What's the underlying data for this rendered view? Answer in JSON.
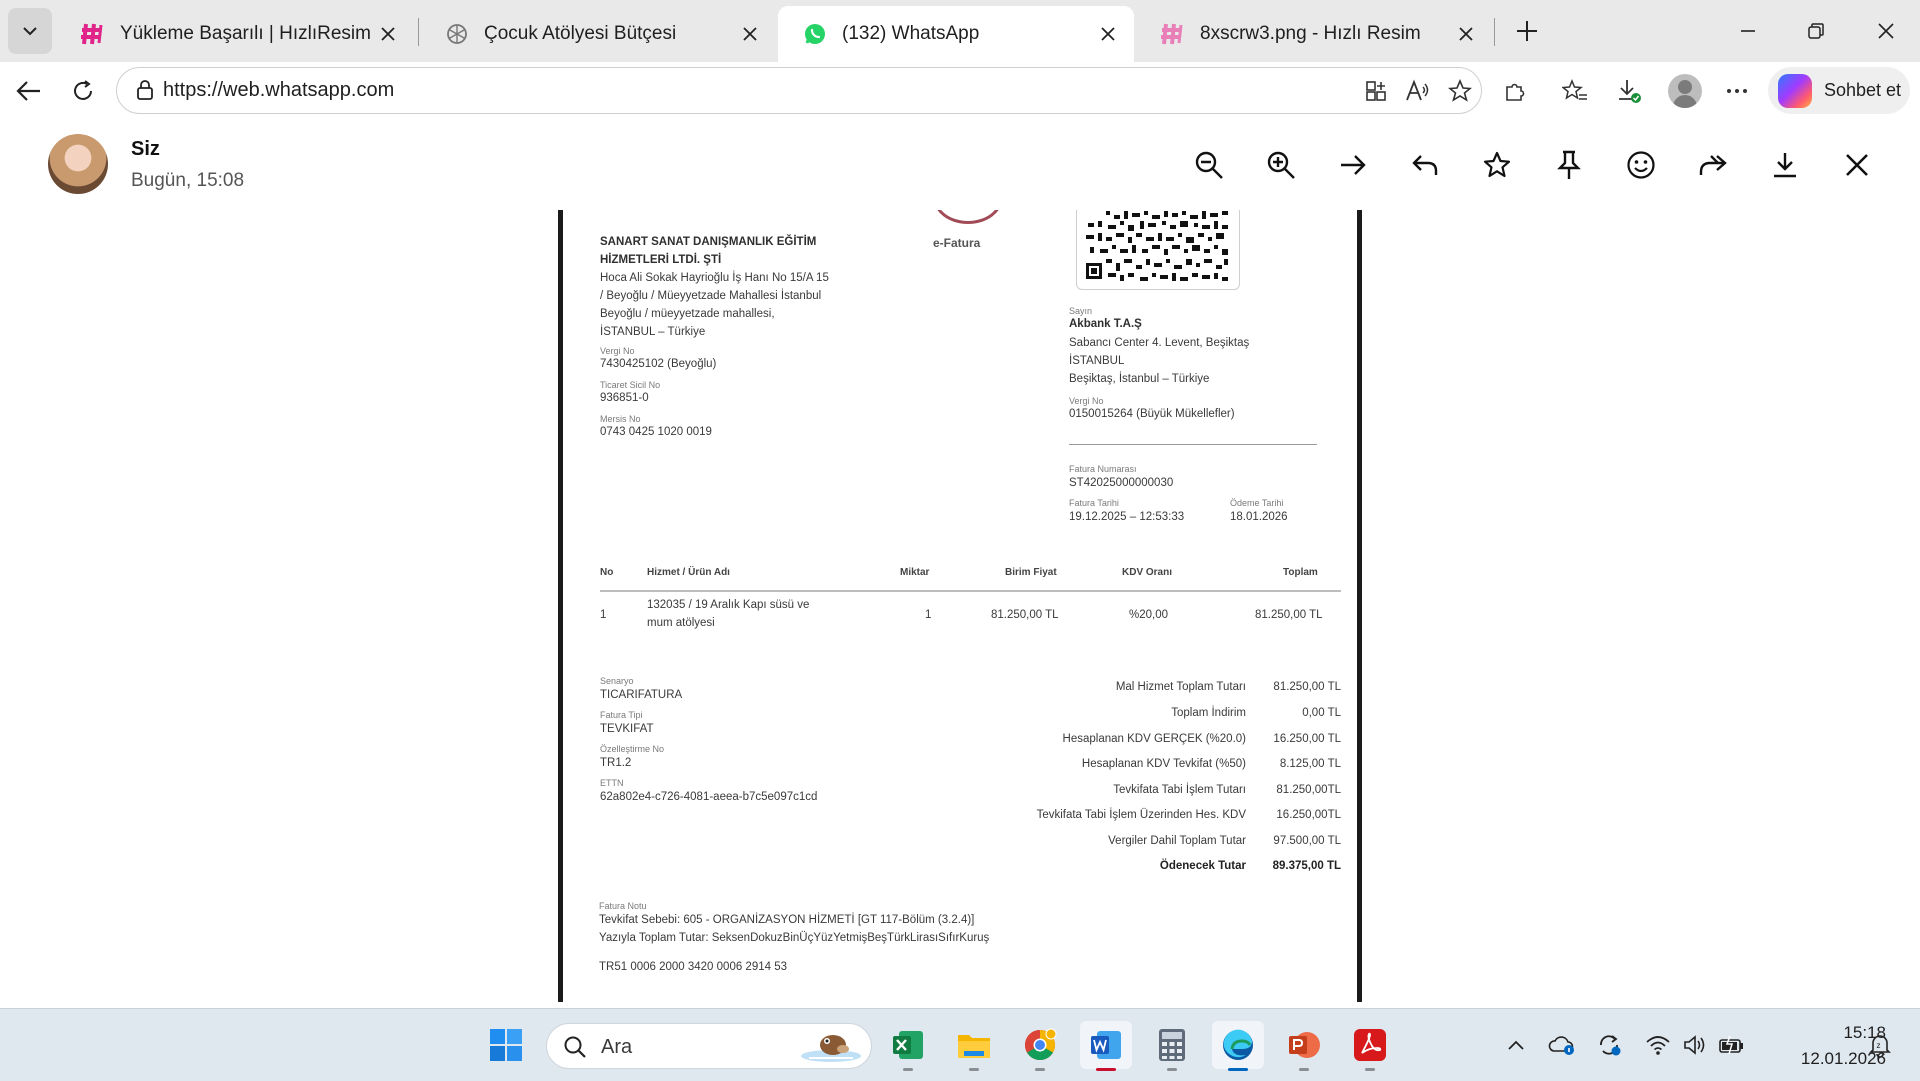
{
  "browser": {
    "tabs": [
      {
        "title": "Yükleme Başarılı | HızlıResim",
        "icon": "hizliresim-icon"
      },
      {
        "title": "Çocuk Atölyesi Bütçesi",
        "icon": "chatgpt-icon"
      },
      {
        "title": "(132) WhatsApp",
        "icon": "whatsapp-icon",
        "active": true
      },
      {
        "title": "8xscrw3.png - Hızlı Resim",
        "icon": "hizliresim-icon"
      }
    ],
    "url": "https://web.whatsapp.com",
    "copilot_label": "Sohbet et"
  },
  "viewer": {
    "sender": "Siz",
    "time": "Bugün, 15:08"
  },
  "invoice": {
    "label": "e-Fatura",
    "seller": {
      "name_line1": "SANART SANAT DANIŞMANLIK EĞİTİM",
      "name_line2": "HİZMETLERİ LTDİ. ŞTİ",
      "address": [
        "Hoca Ali Sokak Hayrioğlu İş Hanı No 15/A 15",
        "/ Beyoğlu / Müeyyetzade Mahallesi İstanbul",
        "Beyoğlu / müeyyetzade mahallesi,",
        "İSTANBUL – Türkiye"
      ],
      "tax_label": "Vergi No",
      "tax_no": "7430425102 (Beyoğlu)",
      "trade_label": "Ticaret Sicil No",
      "trade_no": "936851-0",
      "mersis_label": "Mersis No",
      "mersis_no": "0743 0425 1020 0019"
    },
    "buyer": {
      "label": "Sayın",
      "name": "Akbank T.A.Ş",
      "address": [
        "Sabancı Center 4. Levent, Beşiktaş",
        "İSTANBUL",
        "Beşiktaş, İstanbul – Türkiye"
      ],
      "tax_label": "Vergi No",
      "tax_no": "0150015264 (Büyük Mükellefler)"
    },
    "number_label": "Fatura Numarası",
    "number": "ST42025000000030",
    "date_label": "Fatura Tarihi",
    "date": "19.12.2025 – 12:53:33",
    "due_label": "Ödeme Tarihi",
    "due": "18.01.2026",
    "table": {
      "headers": [
        "No",
        "Hizmet / Ürün Adı",
        "Miktar",
        "Birim Fiyat",
        "KDV Oranı",
        "Toplam"
      ],
      "row": {
        "no": "1",
        "name_line1": "132035 / 19 Aralık Kapı süsü ve",
        "name_line2": "mum atölyesi",
        "qty": "1",
        "unit_price": "81.250,00 TL",
        "vat_rate": "%20,00",
        "total": "81.250,00 TL"
      }
    },
    "meta": [
      {
        "label": "Senaryo",
        "value": "TICARIFATURA"
      },
      {
        "label": "Fatura Tipi",
        "value": "TEVKIFAT"
      },
      {
        "label": "Özelleştirme No",
        "value": "TR1.2"
      },
      {
        "label": "ETTN",
        "value": "62a802e4-c726-4081-aeea-b7c5e097c1cd"
      }
    ],
    "totals": [
      {
        "label": "Mal Hizmet Toplam Tutarı",
        "value": "81.250,00 TL"
      },
      {
        "label": "Toplam İndirim",
        "value": "0,00 TL"
      },
      {
        "label": "Hesaplanan KDV GERÇEK (%20.0)",
        "value": "16.250,00 TL"
      },
      {
        "label": "Hesaplanan KDV Tevkifat (%50)",
        "value": "8.125,00 TL"
      },
      {
        "label": "Tevkifata Tabi İşlem Tutarı",
        "value": "81.250,00TL"
      },
      {
        "label": "Tevkifata Tabi İşlem Üzerinden Hes. KDV",
        "value": "16.250,00TL"
      },
      {
        "label": "Vergiler Dahil Toplam Tutar",
        "value": "97.500,00 TL"
      },
      {
        "label": "Ödenecek Tutar",
        "value": "89.375,00 TL"
      }
    ],
    "note_label": "Fatura Notu",
    "note_line1": "Tevkifat Sebebi: 605 - ORGANİZASYON HİZMETİ [GT 117-Bölüm (3.2.4)]",
    "note_line2": "Yazıyla Toplam Tutar: SeksenDokuzBinÜçYüzYetmişBeşTürkLirasıSıfırKuruş",
    "iban": "TR51 0006 2000 3420 0006 2914 53"
  },
  "taskbar": {
    "search_placeholder": "Ara",
    "time": "15:18",
    "date": "12.01.2026"
  }
}
